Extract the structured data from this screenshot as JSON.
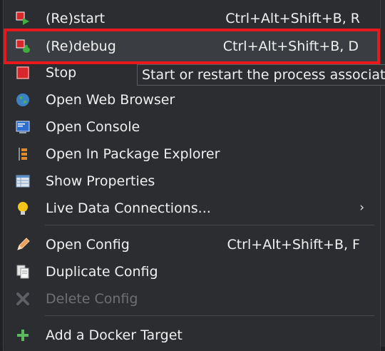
{
  "menu": {
    "items": [
      {
        "label": "(Re)start",
        "accel": "Ctrl+Alt+Shift+B, R",
        "icon": "restart-icon"
      },
      {
        "label": "(Re)debug",
        "accel": "Ctrl+Alt+Shift+B, D",
        "icon": "debug-icon"
      },
      {
        "label": "Stop",
        "icon": "stop-icon"
      },
      {
        "label": "Open Web Browser",
        "icon": "globe-icon"
      },
      {
        "label": "Open Console",
        "icon": "console-icon"
      },
      {
        "label": "Open In Package Explorer",
        "icon": "package-explorer-icon"
      },
      {
        "label": "Show Properties",
        "icon": "properties-icon"
      },
      {
        "label": "Live Data Connections...",
        "icon": "lightbulb-icon",
        "submenu": "›"
      },
      {
        "label": "Open Config",
        "accel": "Ctrl+Alt+Shift+B, F",
        "icon": "pencil-icon"
      },
      {
        "label": "Duplicate Config",
        "icon": "duplicate-icon"
      },
      {
        "label": "Delete Config",
        "icon": "delete-icon",
        "disabled": true
      },
      {
        "label": "Add a Docker Target",
        "icon": "add-icon"
      }
    ]
  },
  "tooltip": {
    "text": "Start or restart the process associated"
  },
  "colors": {
    "menu_bg": "#2b2d30",
    "highlight_border": "#e8191c",
    "text": "#f0f0f0",
    "disabled_text": "#6e7074"
  }
}
